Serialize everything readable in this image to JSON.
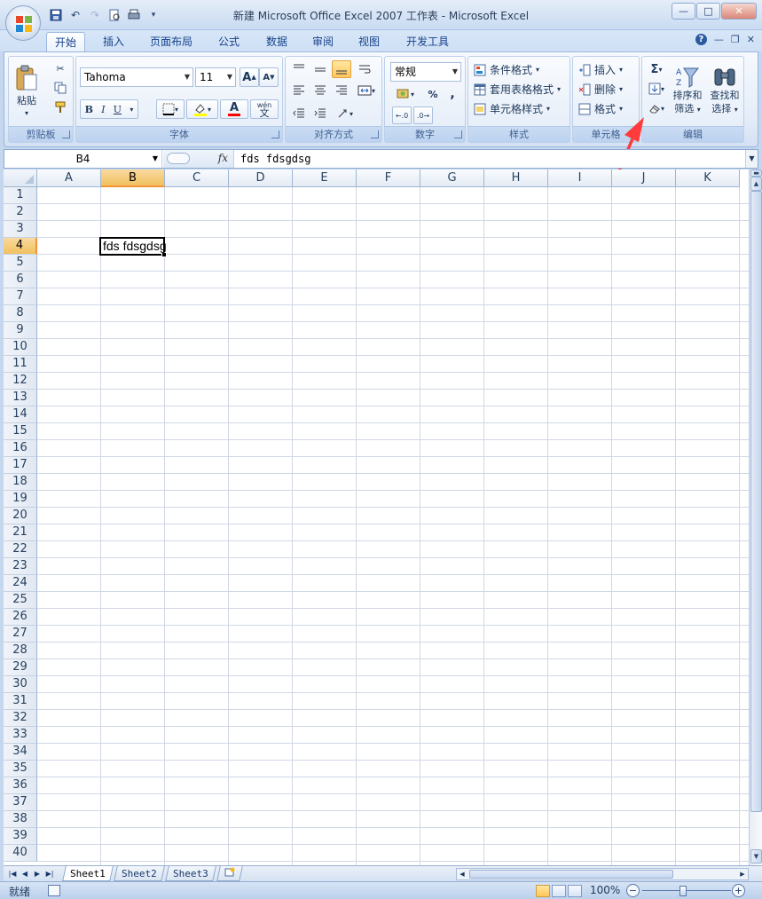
{
  "window": {
    "title": "新建 Microsoft Office Excel 2007 工作表 - Microsoft Excel"
  },
  "tabs": [
    {
      "label": "开始",
      "active": true
    },
    {
      "label": "插入"
    },
    {
      "label": "页面布局"
    },
    {
      "label": "公式"
    },
    {
      "label": "数据"
    },
    {
      "label": "审阅"
    },
    {
      "label": "视图"
    },
    {
      "label": "开发工具"
    }
  ],
  "ribbon": {
    "clipboard": {
      "label": "剪贴板",
      "paste": "粘贴"
    },
    "font": {
      "label": "字体",
      "name": "Tahoma",
      "size": "11",
      "bold": "B",
      "italic": "I",
      "underline": "U",
      "grow": "A",
      "shrink": "A",
      "color_letter": "A",
      "phonetic": "wén"
    },
    "alignment": {
      "label": "对齐方式"
    },
    "number": {
      "label": "数字",
      "format": "常规",
      "percent": "%",
      "comma": ","
    },
    "styles": {
      "label": "样式",
      "conditional": "条件格式",
      "table": "套用表格格式",
      "cell": "单元格样式"
    },
    "cells": {
      "label": "单元格",
      "insert": "插入",
      "delete": "删除",
      "format": "格式"
    },
    "editing": {
      "label": "编辑",
      "sort_line1": "排序和",
      "sort_line2": "筛选",
      "find_line1": "查找和",
      "find_line2": "选择"
    }
  },
  "formula_bar": {
    "name_box": "B4",
    "fx": "fx",
    "content": "fds fdsgdsg"
  },
  "grid": {
    "columns": [
      "A",
      "B",
      "C",
      "D",
      "E",
      "F",
      "G",
      "H",
      "I",
      "J",
      "K"
    ],
    "rows": [
      "1",
      "2",
      "3",
      "4",
      "5",
      "6",
      "7",
      "8",
      "9",
      "10",
      "11",
      "12",
      "13",
      "14",
      "15",
      "16",
      "17",
      "18",
      "19",
      "20",
      "21",
      "22",
      "23",
      "24",
      "25",
      "26",
      "27",
      "28",
      "29",
      "30",
      "31",
      "32",
      "33",
      "34",
      "35",
      "36",
      "37",
      "38",
      "39",
      "40"
    ],
    "selected_column": "B",
    "selected_row": "4",
    "cell_b4": "fds fdsgdsg"
  },
  "sheets": [
    {
      "label": "Sheet1",
      "active": true
    },
    {
      "label": "Sheet2"
    },
    {
      "label": "Sheet3"
    }
  ],
  "status": {
    "ready": "就绪",
    "zoom": "100%",
    "zoom_minus": "−",
    "zoom_plus": "+"
  },
  "colors": {
    "accent": "#ff3b3b",
    "selection": "#f1c15f",
    "ribbon": "#dbe7f7"
  }
}
